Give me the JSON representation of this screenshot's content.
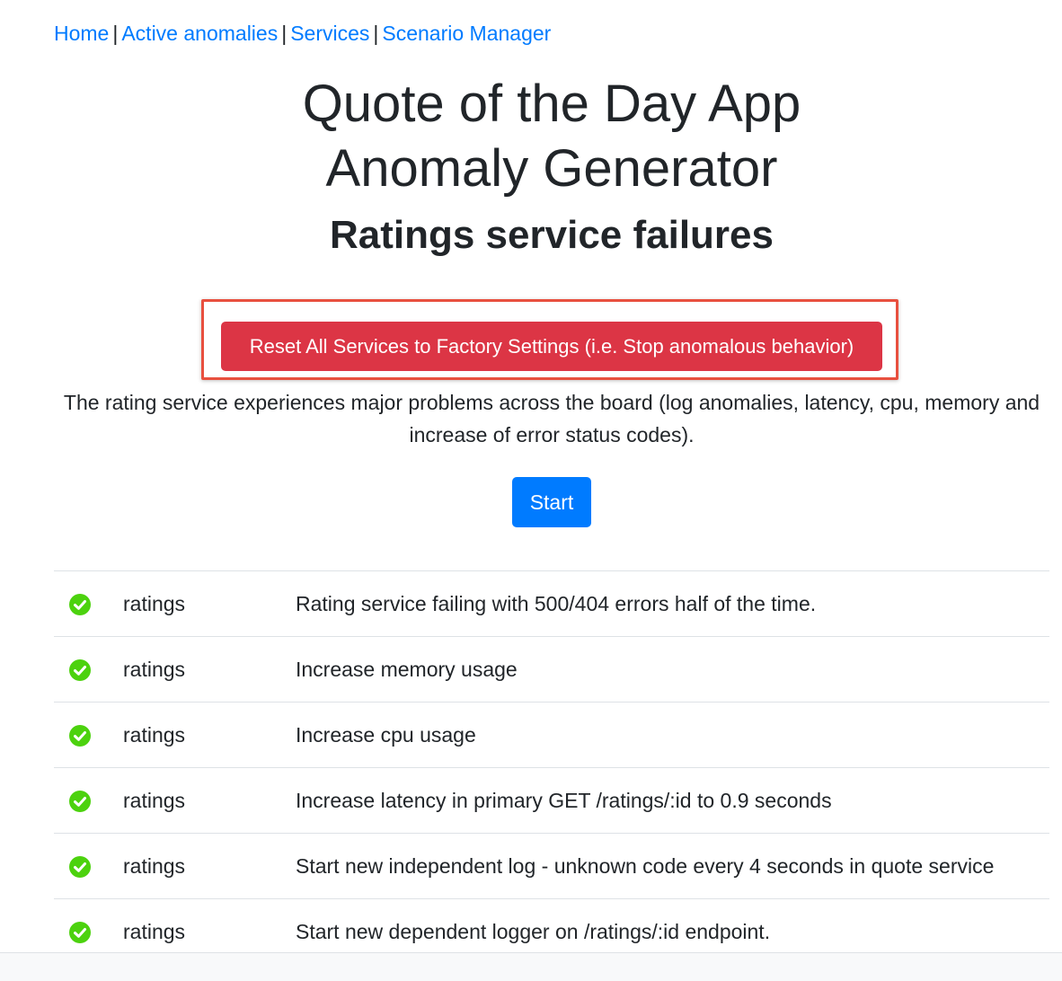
{
  "nav": {
    "links": [
      {
        "label": "Home"
      },
      {
        "label": "Active anomalies"
      },
      {
        "label": "Services"
      },
      {
        "label": "Scenario Manager"
      }
    ],
    "separator": "|"
  },
  "header": {
    "title_line1": "Quote of the Day App",
    "title_line2": "Anomaly Generator",
    "subtitle": "Ratings service failures"
  },
  "actions": {
    "reset_label": "Reset All Services to Factory Settings (i.e. Stop anomalous behavior)",
    "start_label": "Start"
  },
  "description": "The rating service experiences major problems across the board (log anomalies, latency, cpu, memory and increase of error status codes).",
  "steps": [
    {
      "status": "check-circle-icon",
      "service": "ratings",
      "description": "Rating service failing with 500/404 errors half of the time."
    },
    {
      "status": "check-circle-icon",
      "service": "ratings",
      "description": "Increase memory usage"
    },
    {
      "status": "check-circle-icon",
      "service": "ratings",
      "description": "Increase cpu usage"
    },
    {
      "status": "check-circle-icon",
      "service": "ratings",
      "description": "Increase latency in primary GET /ratings/:id to 0.9 seconds"
    },
    {
      "status": "check-circle-icon",
      "service": "ratings",
      "description": "Start new independent log - unknown code every 4 seconds in quote service"
    },
    {
      "status": "check-circle-icon",
      "service": "ratings",
      "description": "Start new dependent logger on /ratings/:id endpoint."
    }
  ],
  "colors": {
    "link": "#007bff",
    "danger": "#dc3545",
    "primary": "#007bff",
    "success_check": "#4cd20e",
    "highlight_border": "#e8503f"
  }
}
